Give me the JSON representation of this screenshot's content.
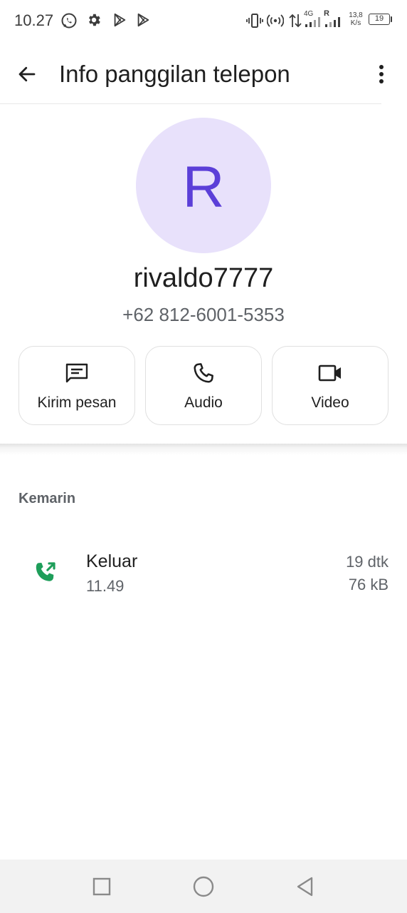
{
  "status_bar": {
    "time": "10.27",
    "network_type": "4G",
    "roaming": "R",
    "net_speed_value": "13,8",
    "net_speed_unit": "K/s",
    "battery": "19",
    "icons": [
      "whatsapp-icon",
      "settings-icon",
      "play-store-icon",
      "play-store-icon",
      "vibrate-icon",
      "hotspot-icon",
      "data-transfer-icon",
      "signal-icon",
      "signal-icon",
      "battery-icon"
    ]
  },
  "header": {
    "title": "Info panggilan telepon",
    "back_icon": "arrow-left-icon",
    "more_icon": "more-vert-icon"
  },
  "contact": {
    "avatar_letter": "R",
    "name": "rivaldo7777",
    "phone": "+62 812-6001-5353",
    "avatar_bg": "#e8e1fb",
    "avatar_fg": "#5b3fd8"
  },
  "actions": [
    {
      "label": "Kirim pesan",
      "icon": "message-icon"
    },
    {
      "label": "Audio",
      "icon": "phone-icon"
    },
    {
      "label": "Video",
      "icon": "videocam-icon"
    }
  ],
  "history": {
    "section_label": "Kemarin",
    "calls": [
      {
        "type": "Keluar",
        "time": "11.49",
        "duration": "19 dtk",
        "size": "76 kB",
        "icon": "outgoing-call-icon",
        "icon_color": "#1e9e5a"
      }
    ]
  },
  "nav_bar": {
    "buttons": [
      "recents-square-icon",
      "home-circle-icon",
      "back-triangle-icon"
    ]
  }
}
